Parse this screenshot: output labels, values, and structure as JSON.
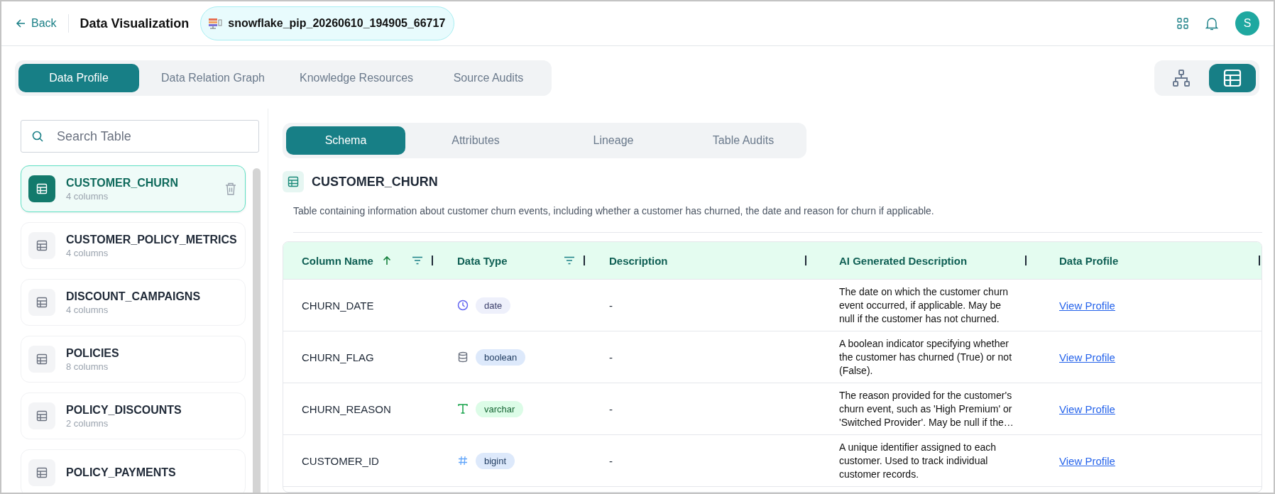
{
  "header": {
    "back": "Back",
    "title": "Data Visualization",
    "source": "snowflake_pip_20260610_194905_66717",
    "avatar": "S"
  },
  "main_tabs": [
    {
      "label": "Data Profile",
      "selected": true
    },
    {
      "label": "Data Relation Graph",
      "selected": false
    },
    {
      "label": "Knowledge Resources",
      "selected": false
    },
    {
      "label": "Source Audits",
      "selected": false
    }
  ],
  "view_toggle": [
    {
      "kind": "graph",
      "selected": false
    },
    {
      "kind": "table",
      "selected": true
    }
  ],
  "sidebar": {
    "search": {
      "placeholder": "Search Table"
    },
    "items": [
      {
        "name": "CUSTOMER_CHURN",
        "count": "4 columns",
        "selected": true
      },
      {
        "name": "CUSTOMER_POLICY_METRICS",
        "count": "4 columns",
        "selected": false
      },
      {
        "name": "DISCOUNT_CAMPAIGNS",
        "count": "4 columns",
        "selected": false
      },
      {
        "name": "POLICIES",
        "count": "8 columns",
        "selected": false
      },
      {
        "name": "POLICY_DISCOUNTS",
        "count": "2 columns",
        "selected": false
      },
      {
        "name": "POLICY_PAYMENTS",
        "selected": false
      }
    ]
  },
  "sub_tabs": [
    {
      "label": "Schema",
      "selected": true
    },
    {
      "label": "Attributes",
      "selected": false
    },
    {
      "label": "Lineage",
      "selected": false
    },
    {
      "label": "Table Audits",
      "selected": false
    }
  ],
  "table_title": "CUSTOMER_CHURN",
  "table_description": "Table containing information about customer churn events, including whether a customer has churned, the date and reason for churn if applicable.",
  "table": {
    "columns": [
      "Column Name",
      "Data Type",
      "Description",
      "AI Generated Description",
      "Data Profile"
    ],
    "rows": [
      {
        "name": "CHURN_DATE",
        "type": {
          "kind": "date",
          "label": "date"
        },
        "description": "-",
        "ai_description": "The date on which the customer churn event occurred, if applicable. May be null if the customer has not churned.",
        "link": "View Profile"
      },
      {
        "name": "CHURN_FLAG",
        "type": {
          "kind": "boolean",
          "label": "boolean"
        },
        "description": "-",
        "ai_description": "A boolean indicator specifying whether the customer has churned (True) or not (False).",
        "link": "View Profile"
      },
      {
        "name": "CHURN_REASON",
        "type": {
          "kind": "varchar",
          "label": "varchar"
        },
        "description": "-",
        "ai_description": "The reason provided for the customer's churn event, such as 'High Premium' or 'Switched Provider'. May be null if the…",
        "link": "View Profile"
      },
      {
        "name": "CUSTOMER_ID",
        "type": {
          "kind": "bigint",
          "label": "bigint"
        },
        "description": "-",
        "ai_description": "A unique identifier assigned to each customer. Used to track individual customer records.",
        "link": "View Profile"
      }
    ]
  }
}
